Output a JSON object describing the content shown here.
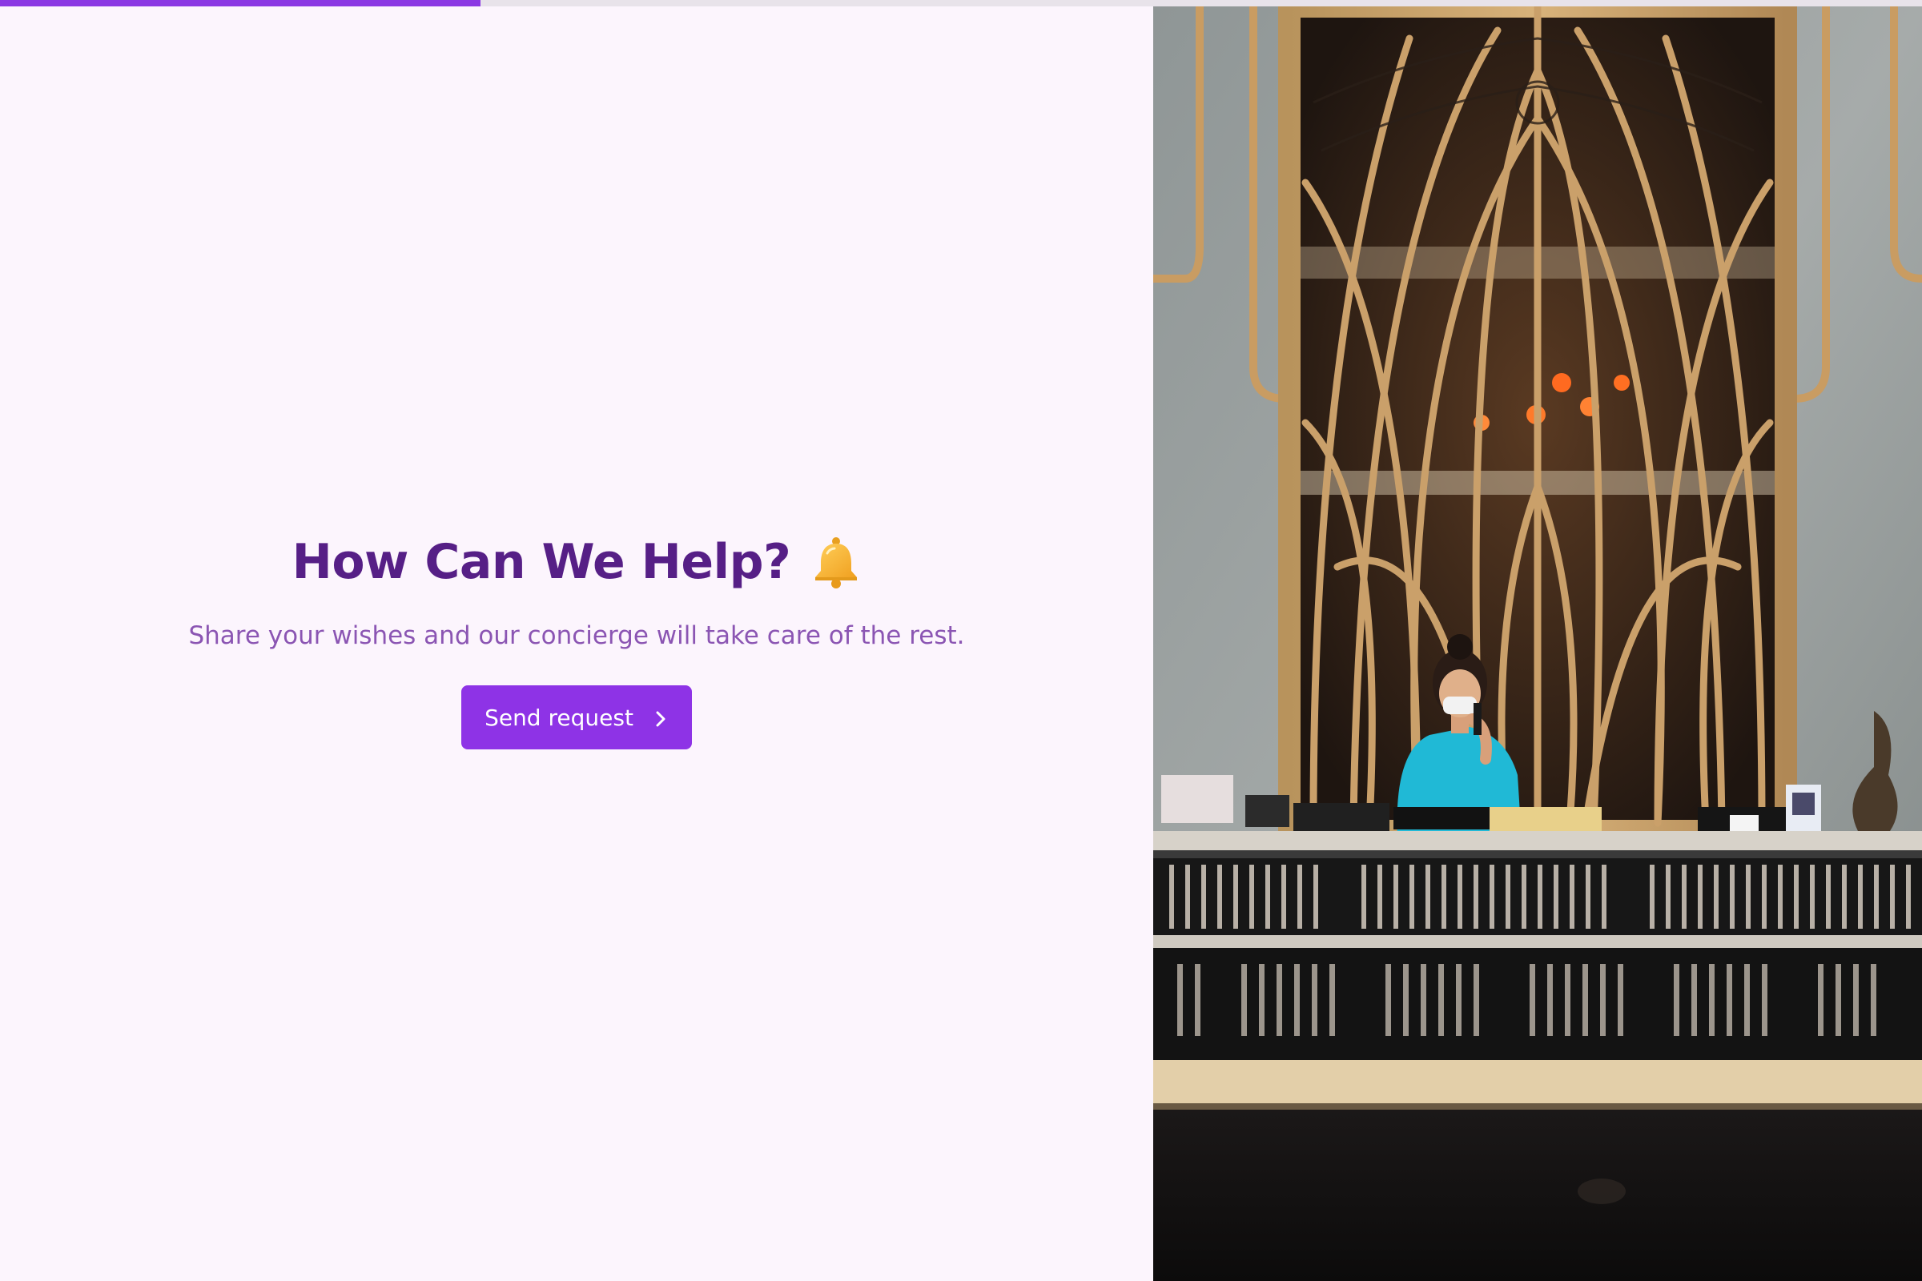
{
  "progress": {
    "fraction": 0.25,
    "fill_color": "#8b38e3"
  },
  "main": {
    "headline": "How Can We Help?",
    "headline_icon": "bell-icon",
    "subtitle": "Share your wishes and our concierge will take care of the rest.",
    "send_button": {
      "label": "Send request",
      "icon": "chevron-right-icon"
    }
  },
  "colors": {
    "background": "#fcf5fd",
    "headline": "#561f86",
    "subtitle": "#8b55b3",
    "accent": "#8e33e6"
  },
  "hero_image": {
    "subject": "hotel-reception-photo"
  }
}
